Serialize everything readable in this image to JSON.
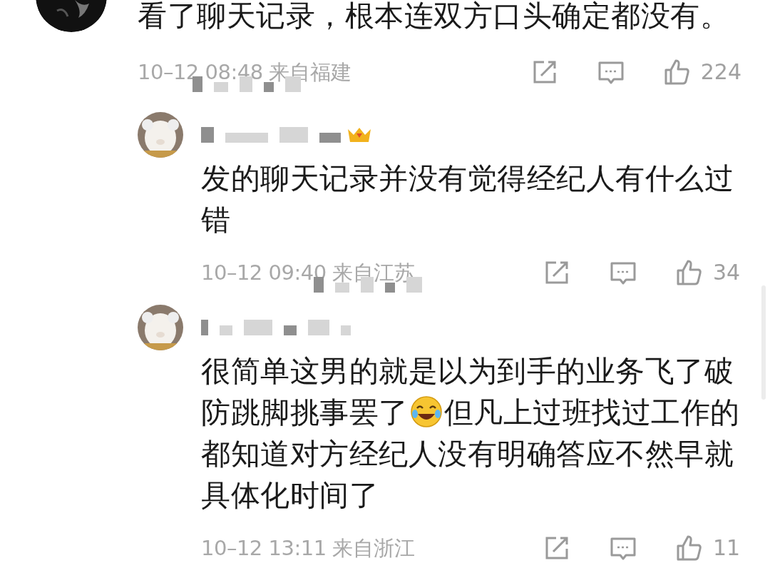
{
  "comments": [
    {
      "kind": "top",
      "text_parts": [
        "看了聊天记录，根本连双方口头确定都没有。"
      ],
      "time": "10–12 08:48",
      "location": "来自福建",
      "likes": "224",
      "name_redacted": false,
      "meta_redacted": true,
      "badge": false
    },
    {
      "kind": "reply",
      "text_parts": [
        "发的聊天记录并没有觉得经纪人有什么过错"
      ],
      "time": "10–12 09:40",
      "location": "来自江苏",
      "likes": "34",
      "name_redacted": true,
      "meta_redacted": true,
      "badge": true
    },
    {
      "kind": "reply",
      "text_parts": [
        "很简单这男的就是以为到手的业务飞了破防跳脚挑事罢了",
        "但凡上过班找过工作的都知道对方经纪人没有明确答应不然早就具体化时间了"
      ],
      "time": "10–12 13:11",
      "location": "来自浙江",
      "likes": "11",
      "name_redacted": true,
      "meta_redacted": false,
      "badge": false
    }
  ]
}
